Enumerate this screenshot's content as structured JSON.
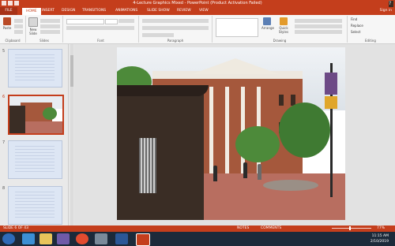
{
  "titlebar": {
    "title": "4-Lecture Graphics Mixed - PowerPoint (Product Activation Failed)",
    "controls": [
      "?",
      "–",
      "□",
      "×"
    ]
  },
  "tabs": [
    {
      "label": "FILE"
    },
    {
      "label": "HOME"
    },
    {
      "label": "INSERT"
    },
    {
      "label": "DESIGN"
    },
    {
      "label": "TRANSITIONS"
    },
    {
      "label": "ANIMATIONS"
    },
    {
      "label": "SLIDE SHOW"
    },
    {
      "label": "REVIEW"
    },
    {
      "label": "VIEW"
    }
  ],
  "signin": "Sign in",
  "ribbon": {
    "groups": [
      {
        "label": "Clipboard"
      },
      {
        "label": "Slides"
      },
      {
        "label": "Font"
      },
      {
        "label": "Paragraph"
      },
      {
        "label": "Drawing"
      },
      {
        "label": "Editing"
      }
    ],
    "paste_label": "Paste",
    "new_slide_label": "New Slide",
    "arrange_label": "Arrange",
    "quick_styles_label": "Quick Styles",
    "find_label": "Find",
    "replace_label": "Replace",
    "select_label": "Select"
  },
  "slides": [
    {
      "number": "5"
    },
    {
      "number": "6"
    },
    {
      "number": "7"
    },
    {
      "number": "8"
    }
  ],
  "status": {
    "slide_info": "SLIDE 6 OF 43",
    "notes": "NOTES",
    "comments": "COMMENTS",
    "zoom": "77%"
  },
  "clock": {
    "time": "11:15 AM",
    "date": "2/10/2019"
  },
  "colors": {
    "accent": "#c43e1c",
    "taskbar": "#1c2a3a"
  }
}
